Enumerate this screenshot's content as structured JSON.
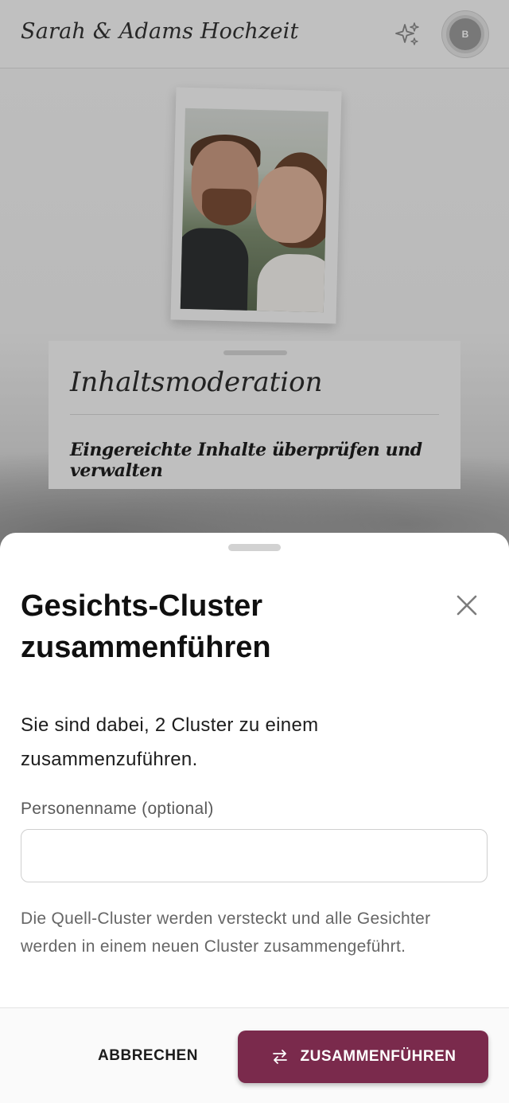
{
  "background": {
    "app_title": "Sarah & Adams Hochzeit",
    "avatar_initial": "B",
    "moderation_card": {
      "title": "Inhaltsmoderation",
      "subtitle": "Eingereichte Inhalte überprüfen und verwalten"
    }
  },
  "dialog": {
    "title": "Gesichts-Cluster zusammenführen",
    "description": "Sie sind dabei, 2 Cluster zu einem zusammenzuführen.",
    "name_label": "Personenname (optional)",
    "name_value": "",
    "name_placeholder": "",
    "hint": "Die Quell-Cluster werden versteckt und alle Gesichter werden in einem neuen Cluster zusammengeführt.",
    "cancel_label": "ABBRECHEN",
    "merge_label": "ZUSAMMENFÜHREN"
  },
  "colors": {
    "accent": "#7a2a4c",
    "sheet_background": "#ffffff",
    "scrim": "rgba(0,0,0,0.22)"
  },
  "icons": {
    "header_action": "sparkles-icon",
    "close": "close-icon",
    "merge": "swap-arrows-icon"
  }
}
